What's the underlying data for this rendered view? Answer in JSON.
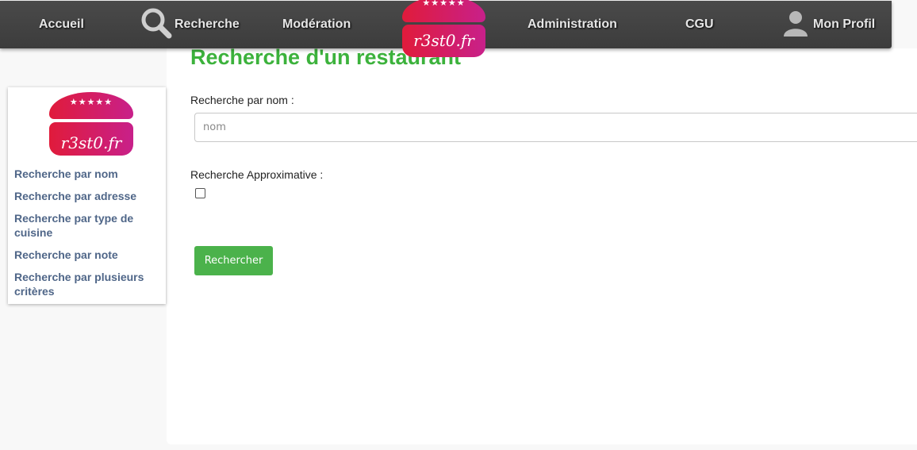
{
  "nav": {
    "items": [
      {
        "label": "Accueil"
      },
      {
        "label": "Recherche",
        "icon": "search-icon"
      },
      {
        "label": "Modération"
      },
      {
        "label": "Administration"
      },
      {
        "label": "CGU"
      },
      {
        "label": "Mon Profil",
        "icon": "user-icon"
      }
    ],
    "logo": {
      "brand": "r3st0.fr",
      "stars": "★★★★★"
    }
  },
  "sidebar": {
    "logo": {
      "brand": "r3st0.fr",
      "stars": "★★★★★"
    },
    "links": [
      {
        "label": "Recherche par nom"
      },
      {
        "label": "Recherche par adresse"
      },
      {
        "label": "Recherche par type de cuisine"
      },
      {
        "label": "Recherche par note"
      },
      {
        "label": "Recherche par plusieurs critères"
      }
    ]
  },
  "main": {
    "title": "Recherche d'un restaurant",
    "name_label": "Recherche par nom :",
    "name_placeholder": "nom",
    "name_value": "",
    "approx_label": "Recherche Approximative :",
    "approx_checked": false,
    "submit_label": "Rechercher"
  },
  "colors": {
    "title": "#3cb23c",
    "button": "#4bb24b",
    "nav_bg": "#404040",
    "link": "#4f6688",
    "logo_gradient_start": "#e01b3b",
    "logo_gradient_end": "#c8208a"
  }
}
